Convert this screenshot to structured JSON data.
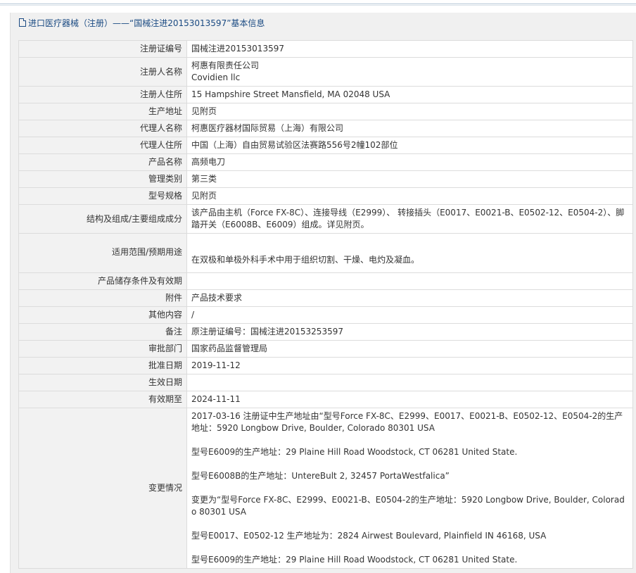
{
  "header": {
    "icon": "document-icon",
    "title": "进口医疗器械（注册）——“国械注进20153013597”基本信息"
  },
  "rows": [
    {
      "label": "注册证编号",
      "value": "国械注进20153013597"
    },
    {
      "label": "注册人名称",
      "value": "柯惠有限责任公司\nCovidien llc"
    },
    {
      "label": "注册人住所",
      "value": "15 Hampshire Street Mansfield, MA 02048 USA"
    },
    {
      "label": "生产地址",
      "value": "见附页"
    },
    {
      "label": "代理人名称",
      "value": "柯惠医疗器材国际贸易（上海）有限公司"
    },
    {
      "label": "代理人住所",
      "value": "中国（上海）自由贸易试验区法赛路556号2幢102部位"
    },
    {
      "label": "产品名称",
      "value": "高频电刀"
    },
    {
      "label": "管理类别",
      "value": "第三类"
    },
    {
      "label": "型号规格",
      "value": "见附页"
    },
    {
      "label": "结构及组成/主要组成成分",
      "value": "该产品由主机（Force FX-8C）、连接导线（E2999）、 转接插头（E0017、E0021-B、E0502-12、E0504-2）、脚踏开关（E6008B、E6009）组成。详见附页。"
    },
    {
      "label": "适用范围/预期用途",
      "value": "在双极和单极外科手术中用于组织切割、干燥、电灼及凝血。"
    },
    {
      "label": "产品储存条件及有效期",
      "value": ""
    },
    {
      "label": "附件",
      "value": "产品技术要求"
    },
    {
      "label": "其他内容",
      "value": "/"
    },
    {
      "label": "备注",
      "value": "原注册证编号：国械注进20153253597"
    },
    {
      "label": "审批部门",
      "value": "国家药品监督管理局"
    },
    {
      "label": "批准日期",
      "value": "2019-11-12"
    },
    {
      "label": "生效日期",
      "value": ""
    },
    {
      "label": "有效期至",
      "value": "2024-11-11"
    }
  ],
  "change_row": {
    "label": "变更情况",
    "paragraphs": [
      "2017-03-16 注册证中生产地址由“型号Force FX-8C、E2999、E0017、E0021-B、E0502-12、E0504-2的生产地址：5920 Longbow Drive, Boulder, Colorado 80301 USA",
      "型号E6009的生产地址：29 Plaine Hill Road Woodstock, CT 06281 United State.",
      "型号E6008B的生产地址：UntereBult 2, 32457 PortaWestfalica”",
      "变更为“型号Force FX-8C、E2999、E0021-B、E0504-2的生产地址：5920 Longbow Drive, Boulder, Colorado 80301 USA",
      "型号E0017、E0502-12 生产地址为：2824 Airwest Boulevard, Plainfield IN 46168, USA",
      "型号E6009的生产地址：29 Plaine Hill Road Woodstock, CT 06281 United State."
    ]
  }
}
